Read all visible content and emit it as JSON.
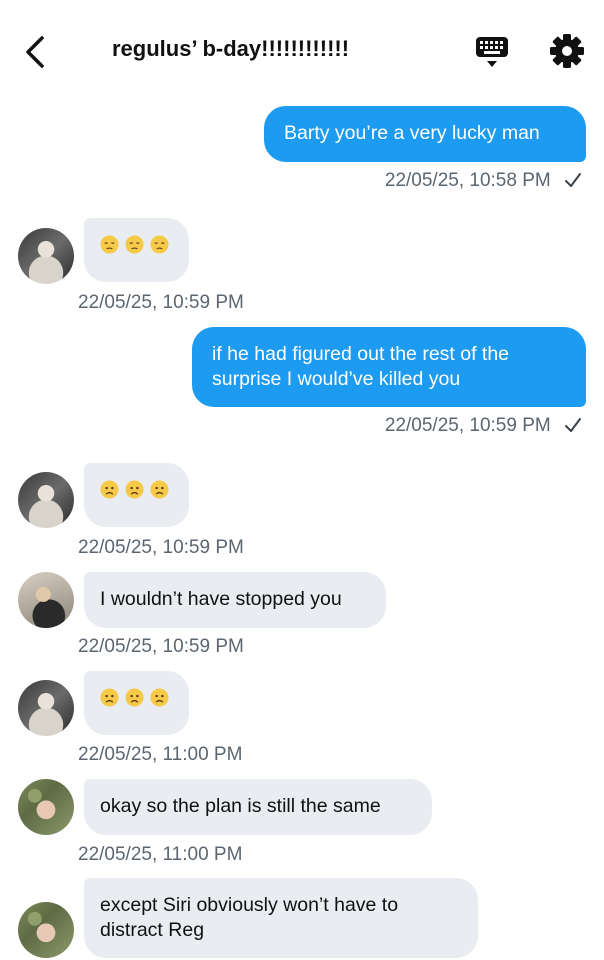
{
  "header": {
    "title": "regulus’ b-day!!!!!!!!!!!!",
    "back_icon": "chevron-left-icon",
    "keyboard_icon": "keyboard-icon",
    "settings_icon": "gear-icon"
  },
  "colors": {
    "outgoing_bubble": "#1d9bf0",
    "incoming_bubble": "#e9ecf0",
    "timestamp": "#5b6670"
  },
  "messages": [
    {
      "direction": "outgoing",
      "text": "Barty you’re a very lucky man",
      "timestamp": "22/05/25, 10:58 PM",
      "status": "sent-check"
    },
    {
      "direction": "incoming",
      "avatar": "avatar-a",
      "emojis": [
        "pensive-face",
        "pensive-face",
        "pensive-face"
      ],
      "timestamp": "22/05/25, 10:59 PM"
    },
    {
      "direction": "outgoing",
      "text": "if he had figured out the rest of the surprise I would’ve killed you",
      "timestamp": "22/05/25, 10:59 PM",
      "status": "sent-check"
    },
    {
      "direction": "incoming",
      "avatar": "avatar-a",
      "emojis": [
        "worried-face",
        "worried-face",
        "worried-face"
      ],
      "timestamp": "22/05/25, 10:59 PM"
    },
    {
      "direction": "incoming",
      "avatar": "avatar-b",
      "text": "I wouldn’t have stopped you",
      "timestamp": "22/05/25, 10:59 PM"
    },
    {
      "direction": "incoming",
      "avatar": "avatar-a",
      "emojis": [
        "worried-face",
        "worried-face",
        "worried-face"
      ],
      "timestamp": "22/05/25, 11:00 PM"
    },
    {
      "direction": "incoming",
      "avatar": "avatar-c",
      "text": "okay so the plan is still the same",
      "timestamp": "22/05/25, 11:00 PM"
    },
    {
      "direction": "incoming",
      "avatar": "avatar-c",
      "text": "except Siri obviously won’t have to distract Reg"
    }
  ]
}
